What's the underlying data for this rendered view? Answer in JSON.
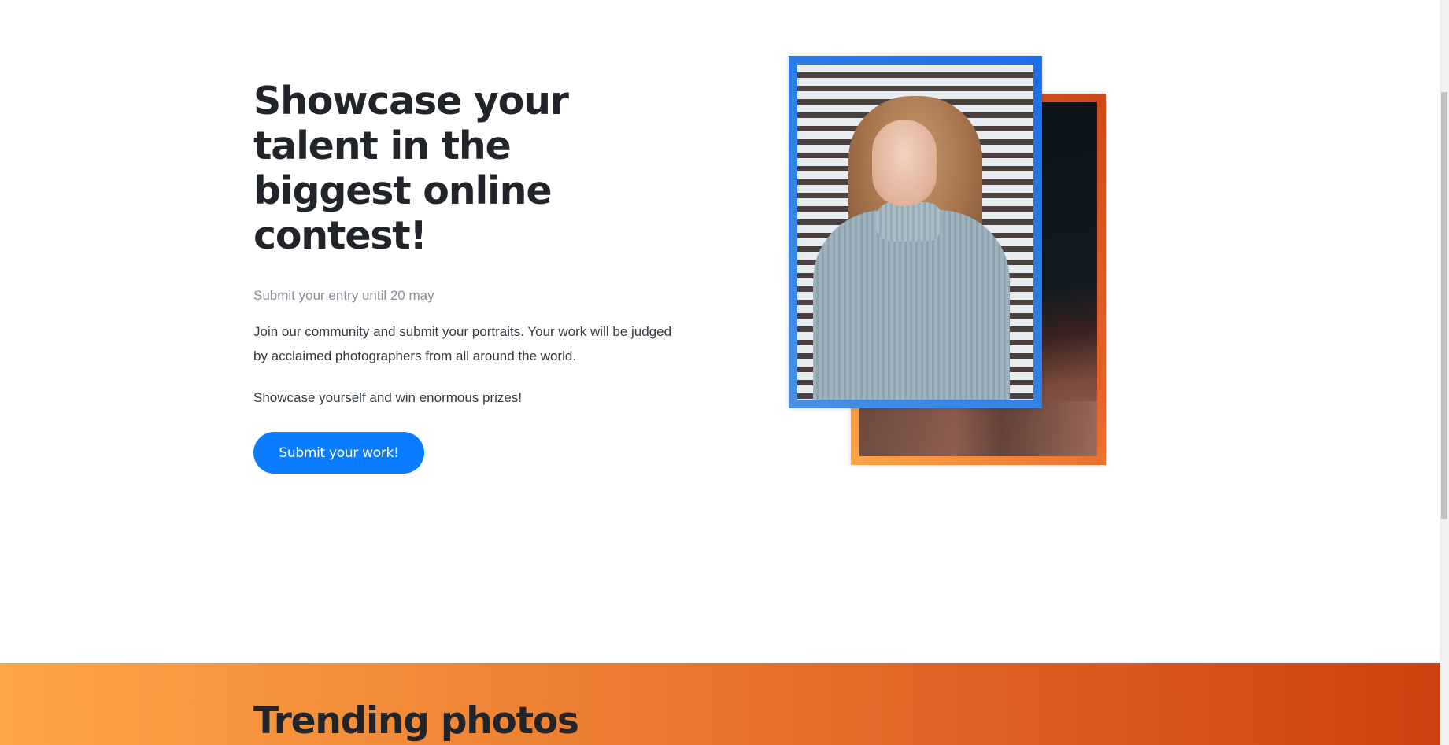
{
  "hero": {
    "title": "Showcase your talent in the biggest online contest!",
    "deadline": "Submit your entry until 20 may",
    "body": "Join our community and submit your portraits. Your work will be judged by acclaimed photographers from all around the world.",
    "body2": "Showcase yourself and win enormous prizes!",
    "cta_label": "Submit your work!"
  },
  "trending": {
    "title": "Trending photos"
  },
  "colors": {
    "accent": "#0a7cff",
    "orange_start": "#ffa646",
    "orange_end": "#d04010",
    "blue_frame": "#2f7fe6"
  }
}
